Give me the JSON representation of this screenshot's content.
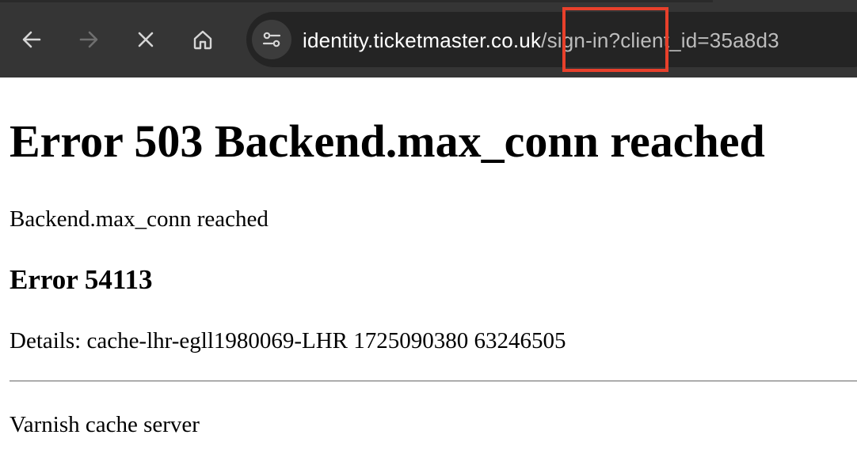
{
  "browser": {
    "nav": {
      "back_icon": "arrow-left-icon",
      "forward_icon": "arrow-right-icon",
      "stop_icon": "close-icon",
      "home_icon": "home-icon"
    },
    "address_bar": {
      "site_info_icon": "tune-icon",
      "url_host": "identity.ticketmaster.co.uk",
      "url_path": "/sign-in?client_id=35a8d3"
    },
    "colors": {
      "toolbar": "#353535",
      "omnibox": "#242424",
      "highlight": "#e8402b"
    }
  },
  "page": {
    "heading": "Error 503 Backend.max_conn reached",
    "message": "Backend.max_conn reached",
    "error_code_heading": "Error 54113",
    "details": "Details: cache-lhr-egll1980069-LHR 1725090380 63246505",
    "footer": "Varnish cache server"
  }
}
